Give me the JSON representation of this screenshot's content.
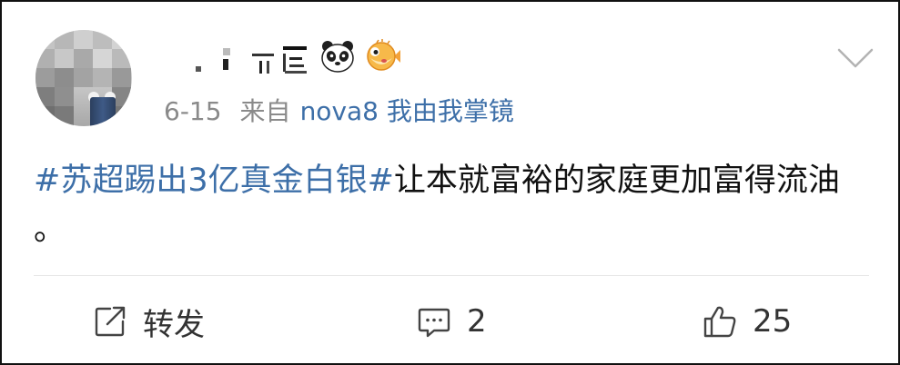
{
  "post": {
    "date": "6-15",
    "from_label": "来自",
    "device": "nova8 我由我掌镜",
    "content": {
      "topic": "#苏超踢出3亿真金白银#",
      "text": "让本就富裕的家庭更加富得流油 。"
    }
  },
  "username_emoji": [
    "panda-emoji",
    "pufferfish-emoji"
  ],
  "actions": {
    "repost_label": "转发",
    "comment_count": "2",
    "like_count": "25"
  },
  "colors": {
    "link": "#3d6fa8",
    "meta": "#8a8a8a",
    "text": "#111111"
  }
}
